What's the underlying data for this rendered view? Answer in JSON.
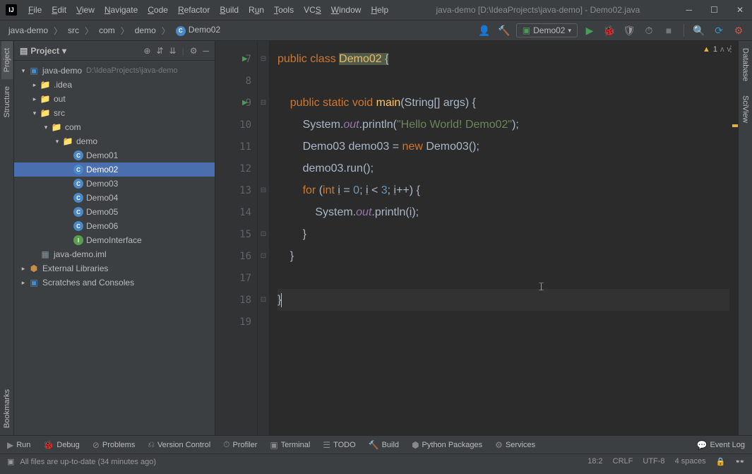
{
  "title": "java-demo [D:\\IdeaProjects\\java-demo] - Demo02.java",
  "menubar": [
    "File",
    "Edit",
    "View",
    "Navigate",
    "Code",
    "Refactor",
    "Build",
    "Run",
    "Tools",
    "VCS",
    "Window",
    "Help"
  ],
  "breadcrumb": {
    "items": [
      "java-demo",
      "src",
      "com",
      "demo",
      "Demo02"
    ]
  },
  "run_config": "Demo02",
  "project_panel": {
    "title": "Project",
    "root_name": "java-demo",
    "root_path": "D:\\IdeaProjects\\java-demo",
    "idea": ".idea",
    "out": "out",
    "src": "src",
    "com": "com",
    "demo": "demo",
    "files": [
      "Demo01",
      "Demo02",
      "Demo03",
      "Demo04",
      "Demo05",
      "Demo06",
      "DemoInterface"
    ],
    "iml": "java-demo.iml",
    "ext_lib": "External Libraries",
    "scratches": "Scratches and Consoles"
  },
  "left_tabs": [
    "Project",
    "Structure",
    "Bookmarks"
  ],
  "right_tabs": [
    "Database",
    "SciView"
  ],
  "editor": {
    "lines_start": 7,
    "warn_count": "1",
    "code": {
      "l7_pre": "public class ",
      "l7_cls": "Demo02",
      "l7_post": " {",
      "l9_pre": "    public static void ",
      "l9_mtd": "main",
      "l9_post1": "(",
      "l9_type": "String",
      "l9_post2": "[] args) {",
      "l10_pre": "        System.",
      "l10_out": "out",
      "l10_mid": ".println(",
      "l10_str": "\"Hello World! Demo02\"",
      "l10_post": ");",
      "l11_pre": "        ",
      "l11_type": "Demo03",
      "l11_mid": " demo03 = ",
      "l11_new": "new ",
      "l11_ctor": "Demo03",
      "l11_post": "();",
      "l12": "        demo03.run();",
      "l13_pre": "        ",
      "l13_for": "for ",
      "l13_open": "(",
      "l13_int": "int ",
      "l13_i1": "i",
      "l13_eq": " = ",
      "l13_z": "0",
      "l13_sc1": "; ",
      "l13_i2": "i",
      "l13_lt": " < ",
      "l13_three": "3",
      "l13_sc2": "; ",
      "l13_i3": "i",
      "l13_pp": "++) {",
      "l14_pre": "            System.",
      "l14_out": "out",
      "l14_mid": ".println(",
      "l14_i": "i",
      "l14_post": ");",
      "l15": "        }",
      "l16": "    }",
      "l18": "}"
    }
  },
  "bottom_bar": {
    "run": "Run",
    "debug": "Debug",
    "problems": "Problems",
    "vcs": "Version Control",
    "profiler": "Profiler",
    "terminal": "Terminal",
    "todo": "TODO",
    "build": "Build",
    "python": "Python Packages",
    "services": "Services",
    "event_log": "Event Log"
  },
  "status": {
    "msg": "All files are up-to-date (34 minutes ago)",
    "pos": "18:2",
    "eol": "CRLF",
    "enc": "UTF-8",
    "indent": "4 spaces"
  }
}
